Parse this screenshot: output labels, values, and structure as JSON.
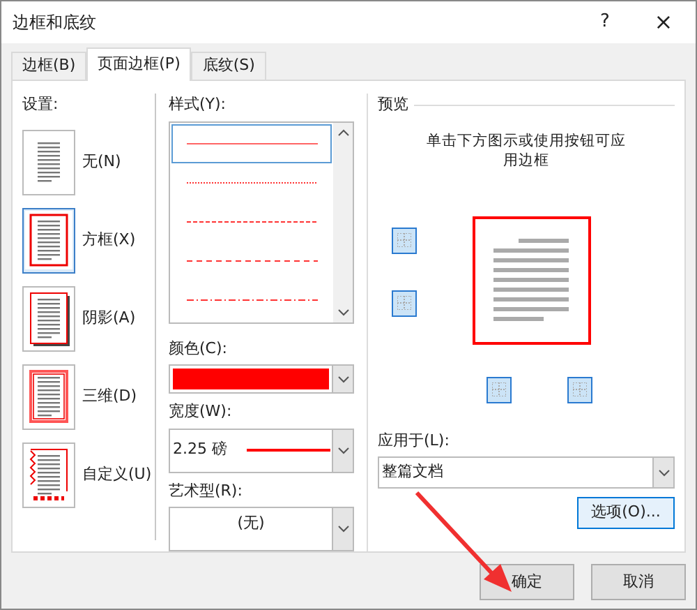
{
  "window": {
    "title": "边框和底纹",
    "help": "?",
    "close": "×"
  },
  "tabs": [
    {
      "label": "边框(B)",
      "selected": false
    },
    {
      "label": "页面边框(P)",
      "selected": true
    },
    {
      "label": "底纹(S)",
      "selected": false
    }
  ],
  "settings": {
    "label": "设置:",
    "items": [
      {
        "kind": "none",
        "label": "无(N)",
        "selected": false
      },
      {
        "kind": "box",
        "label": "方框(X)",
        "selected": true
      },
      {
        "kind": "shadow",
        "label": "阴影(A)",
        "selected": false
      },
      {
        "kind": "threed",
        "label": "三维(D)",
        "selected": false
      },
      {
        "kind": "custom",
        "label": "自定义(U)",
        "selected": false
      }
    ]
  },
  "style": {
    "label": "样式(Y):",
    "items": [
      {
        "kind": "solid",
        "selected": true
      },
      {
        "kind": "dotted",
        "selected": false
      },
      {
        "kind": "dashed",
        "selected": false
      },
      {
        "kind": "longdash",
        "selected": false
      },
      {
        "kind": "dashdot",
        "selected": false
      }
    ]
  },
  "color": {
    "label": "颜色(C):",
    "color": "#ff0000"
  },
  "width": {
    "label": "宽度(W):",
    "value": "2.25 磅"
  },
  "art": {
    "label": "艺术型(R):",
    "value": "(无)"
  },
  "preview": {
    "label": "预览",
    "hint": "单击下方图示或使用按钮可应用边框",
    "side_buttons": [
      {
        "on": true
      },
      {
        "on": true
      },
      {
        "on": true
      },
      {
        "on": true
      }
    ]
  },
  "apply_to": {
    "label": "应用于(L):",
    "value": "整篇文档"
  },
  "options_button": "选项(O)...",
  "buttons": [
    "确定",
    "取消"
  ]
}
